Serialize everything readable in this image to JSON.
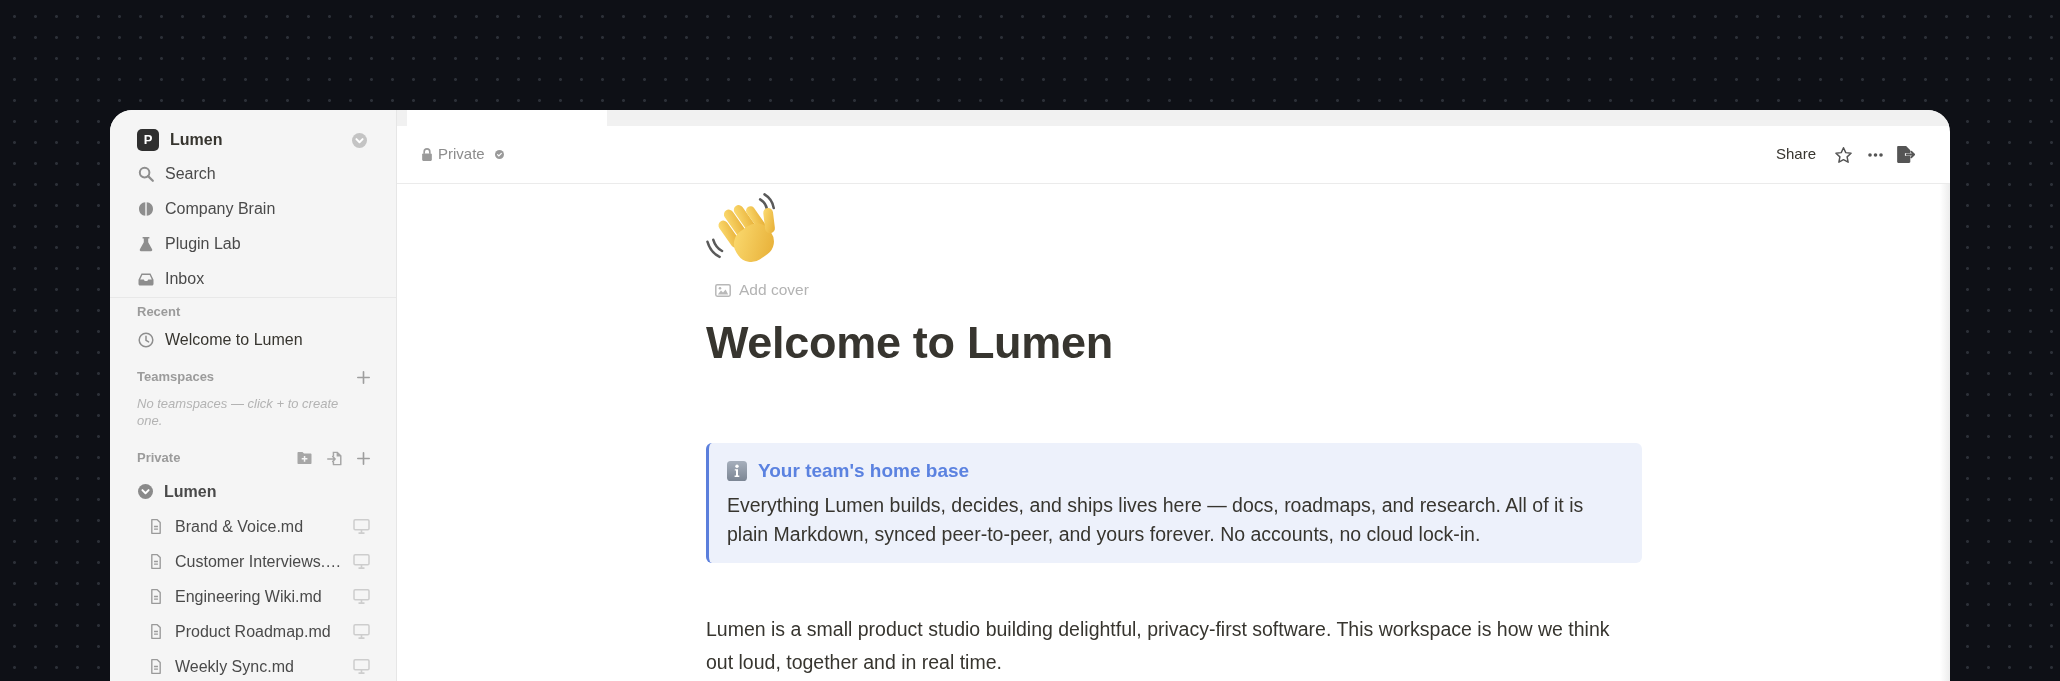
{
  "workspace": {
    "initial": "P",
    "name": "Lumen"
  },
  "nav": [
    {
      "kind": "search",
      "label": "Search"
    },
    {
      "kind": "brain",
      "label": "Company Brain"
    },
    {
      "kind": "lab",
      "label": "Plugin Lab"
    },
    {
      "kind": "inbox",
      "label": "Inbox"
    }
  ],
  "recent": {
    "title": "Recent",
    "items": [
      {
        "label": "Welcome to Lumen"
      }
    ]
  },
  "teamspaces": {
    "title": "Teamspaces",
    "empty_note": "No teamspaces — click + to create one."
  },
  "private": {
    "title": "Private",
    "pages": [
      {
        "label": "Lumen",
        "expanded": true,
        "children": [
          {
            "label": "Brand & Voice.md"
          },
          {
            "label": "Customer Interviews.…"
          },
          {
            "label": "Engineering Wiki.md"
          },
          {
            "label": "Product Roadmap.md"
          },
          {
            "label": "Weekly Sync.md"
          }
        ]
      }
    ]
  },
  "header": {
    "visibility": "Private",
    "share": "Share"
  },
  "page": {
    "add_cover": "Add cover",
    "title": "Welcome to Lumen",
    "callout": {
      "title": "Your team's home base",
      "body": "Everything Lumen builds, decides, and ships lives here — docs, roadmaps, and research. All of it is plain Markdown, synced peer-to-peer, and yours forever. No accounts, no cloud lock-in."
    },
    "paragraphs": [
      "Lumen is a small product studio building delightful, privacy-first software. This workspace is how we think out loud, together and in real time."
    ]
  }
}
